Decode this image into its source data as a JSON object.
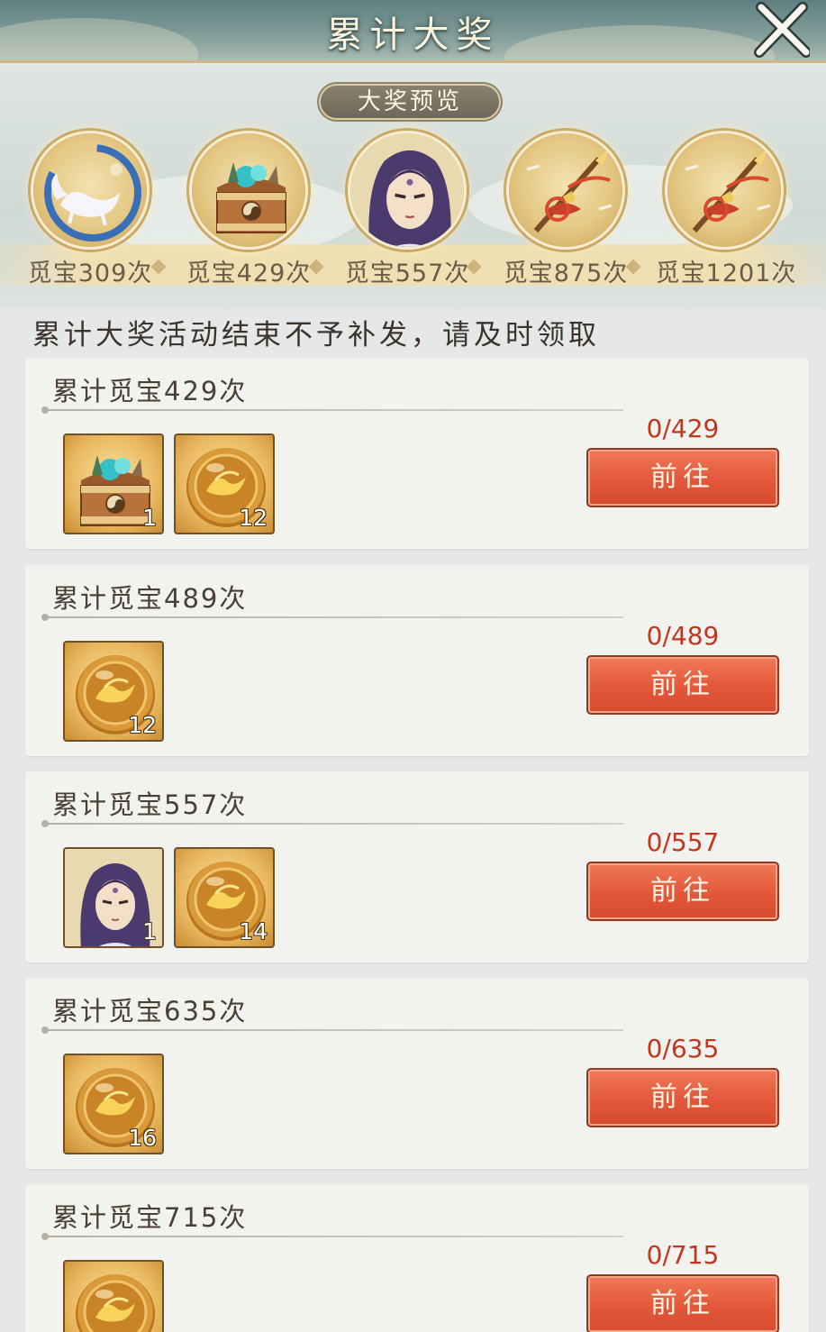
{
  "header": {
    "title": "累计大奖"
  },
  "preview": {
    "pill_label": "大奖预览",
    "prizes": [
      {
        "label": "觅宝309次",
        "icon": "fox-spirit-icon"
      },
      {
        "label": "觅宝429次",
        "icon": "treasure-chest-icon"
      },
      {
        "label": "觅宝557次",
        "icon": "hero-portrait-icon"
      },
      {
        "label": "觅宝875次",
        "icon": "spear-weapon-icon"
      },
      {
        "label": "觅宝1201次",
        "icon": "spear-weapon-icon"
      }
    ]
  },
  "notice": "累计大奖活动结束不予补发，请及时领取",
  "rewards": [
    {
      "title": "累计觅宝429次",
      "progress": "0/429",
      "button": "前往",
      "items": [
        {
          "icon": "treasure-chest-icon",
          "count": "1"
        },
        {
          "icon": "gold-coin-icon",
          "count": "12"
        }
      ]
    },
    {
      "title": "累计觅宝489次",
      "progress": "0/489",
      "button": "前往",
      "items": [
        {
          "icon": "gold-coin-icon",
          "count": "12"
        }
      ]
    },
    {
      "title": "累计觅宝557次",
      "progress": "0/557",
      "button": "前往",
      "items": [
        {
          "icon": "hero-portrait-icon",
          "count": "1"
        },
        {
          "icon": "gold-coin-icon",
          "count": "14"
        }
      ]
    },
    {
      "title": "累计觅宝635次",
      "progress": "0/635",
      "button": "前往",
      "items": [
        {
          "icon": "gold-coin-icon",
          "count": "16"
        }
      ]
    },
    {
      "title": "累计觅宝715次",
      "progress": "0/715",
      "button": "前往",
      "items": [
        {
          "icon": "gold-coin-icon",
          "count": ""
        }
      ]
    }
  ],
  "colors": {
    "accent_button": "#e3573a",
    "progress_text": "#c2361d",
    "gold": "#e4c783"
  }
}
